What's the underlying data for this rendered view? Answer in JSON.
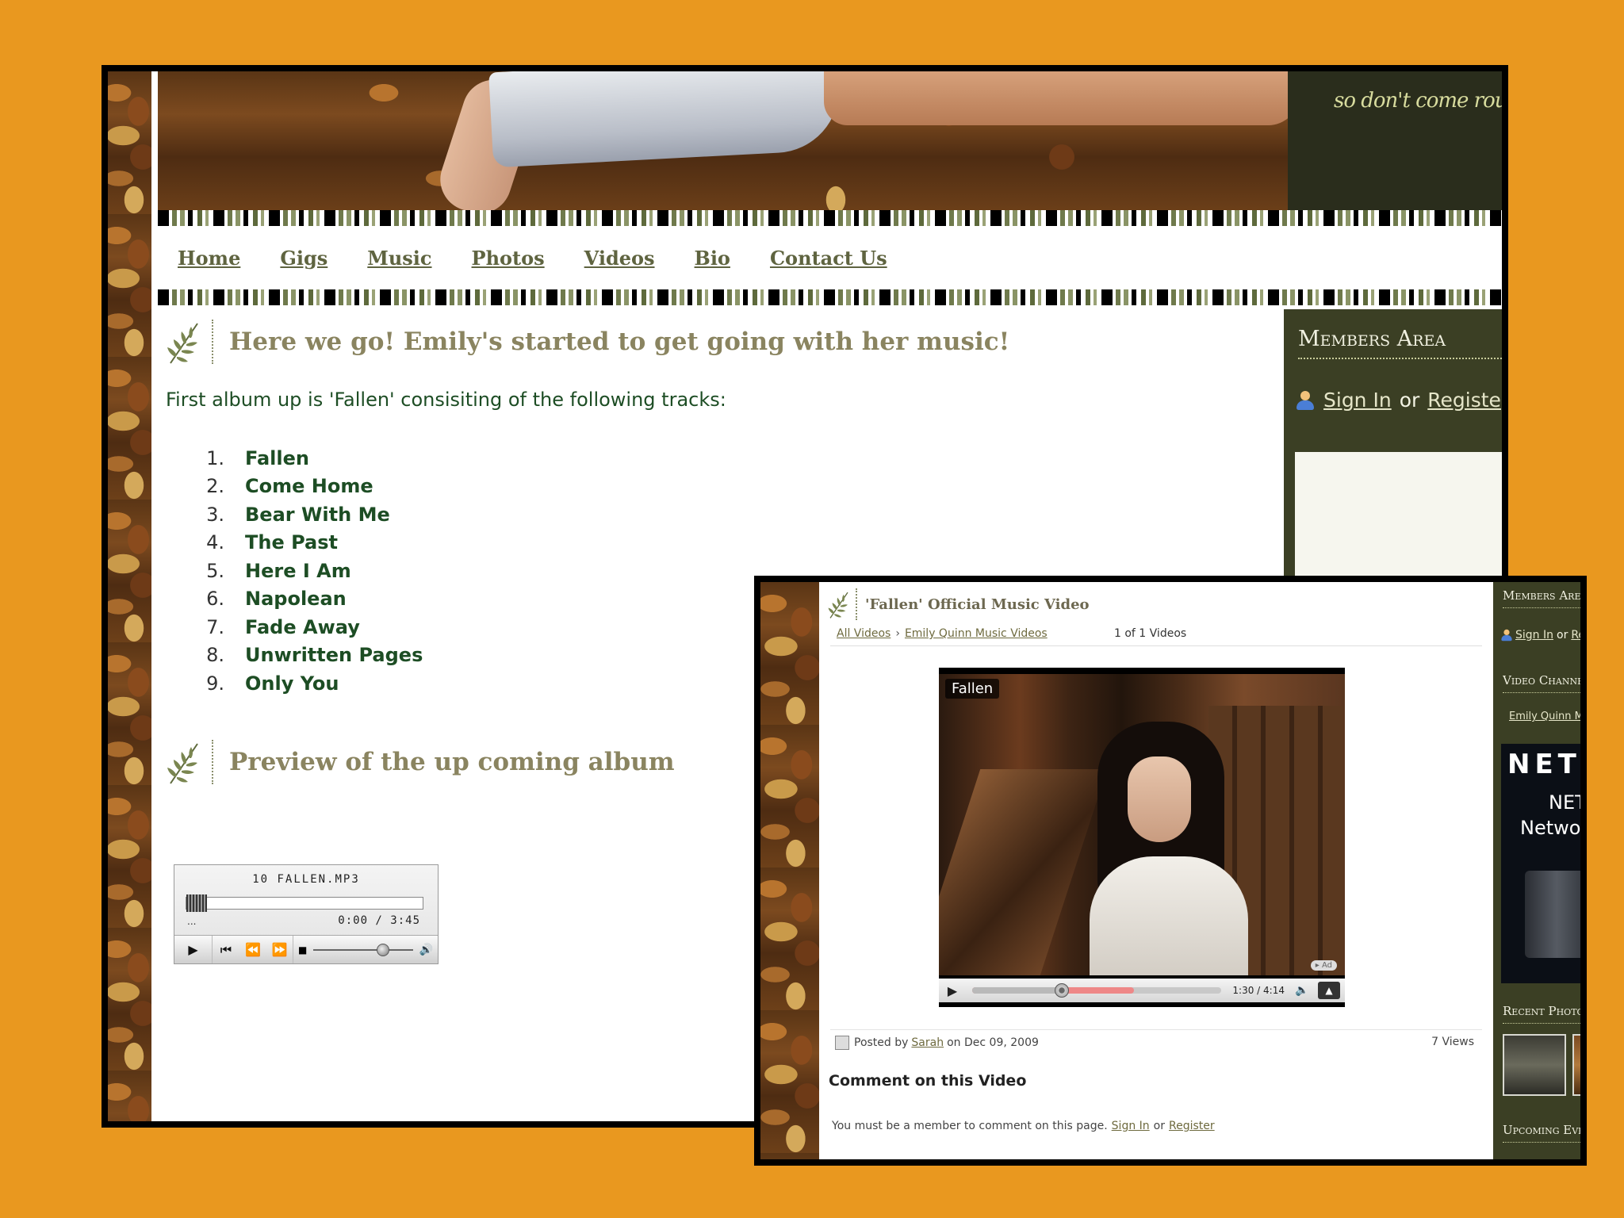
{
  "site": {
    "tagline": "so don't come rour",
    "nav": [
      "Home",
      "Gigs",
      "Music",
      "Photos",
      "Videos",
      "Bio",
      "Contact Us"
    ]
  },
  "post1": {
    "title": "Here we go! Emily's started to get going with her music!",
    "intro": "First album up is 'Fallen' consisiting of the following tracks:",
    "tracks": [
      {
        "num": "1.",
        "name": "Fallen"
      },
      {
        "num": "2.",
        "name": "Come Home"
      },
      {
        "num": "3.",
        "name": "Bear With Me"
      },
      {
        "num": "4.",
        "name": "The Past"
      },
      {
        "num": "5.",
        "name": "Here I Am"
      },
      {
        "num": "6.",
        "name": "Napolean"
      },
      {
        "num": "7.",
        "name": "Fade Away"
      },
      {
        "num": "8.",
        "name": "Unwritten Pages"
      },
      {
        "num": "9.",
        "name": "Only You"
      }
    ]
  },
  "post2": {
    "title": "Preview of the up coming album"
  },
  "audio_player": {
    "file": "10 FALLEN.MP3",
    "dots": "...",
    "time": "0:00 / 3:45",
    "progress": 0,
    "volume": 0.64
  },
  "members": {
    "title": "Members Area",
    "sign_in": "Sign In",
    "or": "or",
    "register": "Registe"
  },
  "video_page": {
    "title": "'Fallen' Official Music Video",
    "breadcrumb": {
      "all": "All Videos",
      "sep": "›",
      "channel": "Emily Quinn Music Videos"
    },
    "count": "1 of 1 Videos",
    "video": {
      "label": "Fallen",
      "ad": "▸ Ad",
      "time": "1:30 / 4:14",
      "played": 0.36,
      "loaded": 0.65
    },
    "posted": {
      "by_prefix": "Posted by",
      "author": "Sarah",
      "date": "on Dec 09, 2009"
    },
    "views": "7 Views",
    "comment_title": "Comment on this Video",
    "comment_note": "You must be a member to comment on this page.",
    "comment_sign_in": "Sign In",
    "comment_or": "or",
    "comment_register": "Register"
  },
  "video_sidebar": {
    "members_title": "Members Area",
    "sign_in": "Sign In",
    "or": "or",
    "register": "Re",
    "channels_title": "Video Channels",
    "channel_link": "Emily Quinn Mus",
    "ad_brand": "NETG",
    "ad_line1": "NETG",
    "ad_line2": "Network",
    "photos_title": "Recent Photos",
    "events_title": "Upcoming Event"
  }
}
